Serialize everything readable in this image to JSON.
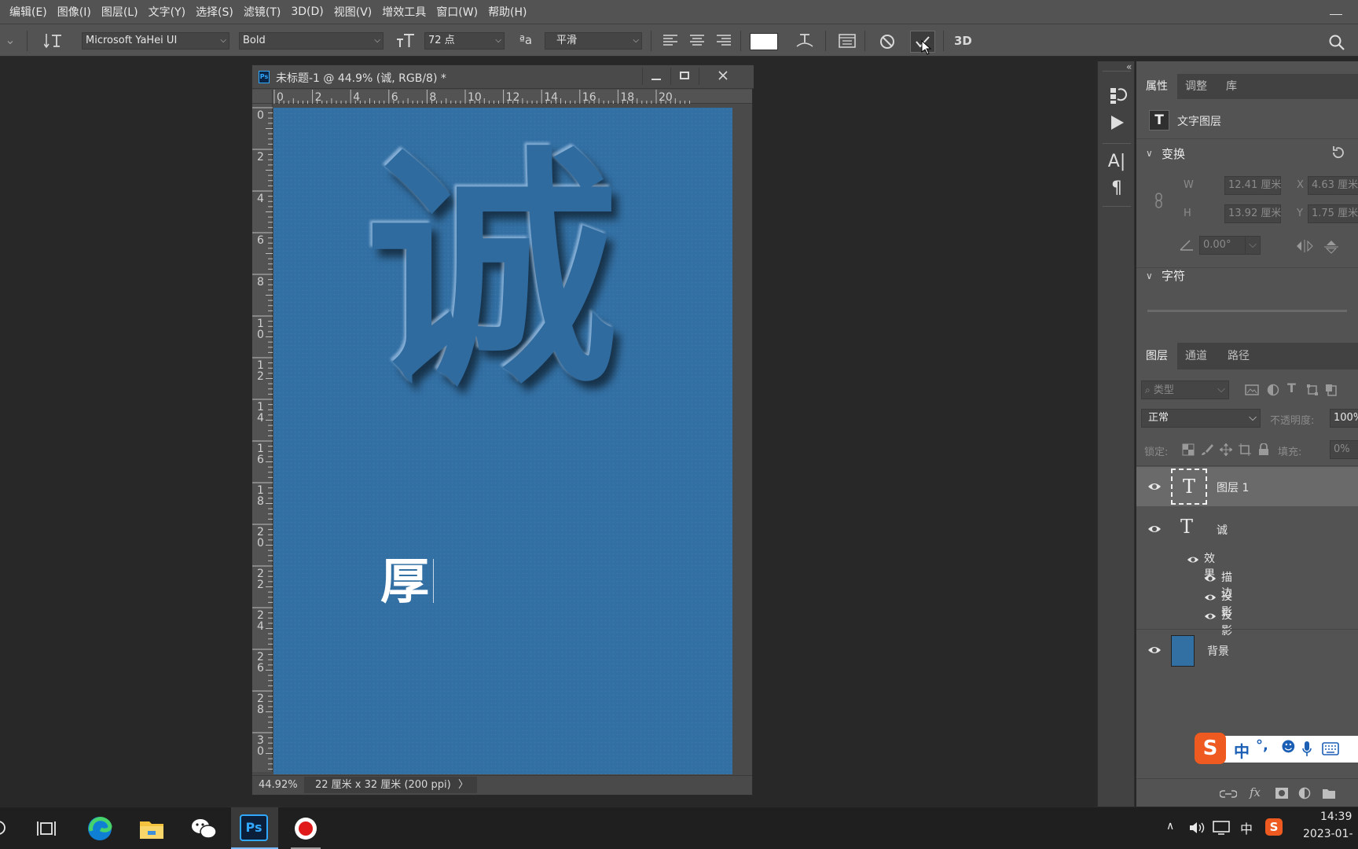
{
  "menubar": {
    "items": [
      "编辑(E)",
      "图像(I)",
      "图层(L)",
      "文字(Y)",
      "选择(S)",
      "滤镜(T)",
      "3D(D)",
      "视图(V)",
      "增效工具",
      "窗口(W)",
      "帮助(H)"
    ]
  },
  "options": {
    "font_family": "Microsoft YaHei UI",
    "font_style": "Bold",
    "font_size": "72 点",
    "antialias": "平滑",
    "three_d": "3D",
    "swatch_color": "#ffffff"
  },
  "document": {
    "title": "未标题-1 @ 44.9% (诚, RGB/8) *",
    "ps_badge": "Ps",
    "ruler_h": [
      "0",
      "2",
      "4",
      "6",
      "8",
      "10",
      "12",
      "14",
      "16",
      "18",
      "20"
    ],
    "ruler_v": [
      [
        "0"
      ],
      [
        "2"
      ],
      [
        "4"
      ],
      [
        "6"
      ],
      [
        "8"
      ],
      [
        "1",
        "0"
      ],
      [
        "1",
        "2"
      ],
      [
        "1",
        "4"
      ],
      [
        "1",
        "6"
      ],
      [
        "1",
        "8"
      ],
      [
        "2",
        "0"
      ],
      [
        "2",
        "2"
      ],
      [
        "2",
        "4"
      ],
      [
        "2",
        "6"
      ],
      [
        "2",
        "8"
      ],
      [
        "3",
        "0"
      ]
    ],
    "big_char": "诚",
    "small_char": "厚",
    "zoom": "44.92%",
    "dims": "22 厘米 x 32 厘米 (200 ppi)",
    "dims_arrow": "〉",
    "canvas_color": "#326fa3"
  },
  "properties": {
    "tabs": [
      "属性",
      "调整",
      "库"
    ],
    "layer_type": "文字图层",
    "transform_title": "变换",
    "w_label": "W",
    "w_value": "12.41 厘米",
    "h_label": "H",
    "h_value": "13.92 厘米",
    "x_label": "X",
    "x_value": "4.63 厘米",
    "y_label": "Y",
    "y_value": "1.75 厘米",
    "angle_value": "0.00°",
    "character_title": "字符"
  },
  "layers": {
    "tabs": [
      "图层",
      "通道",
      "路径"
    ],
    "filter_kind": "类型",
    "blend_mode": "正常",
    "opacity_label": "不透明度:",
    "opacity_value": "100%",
    "lock_label": "锁定:",
    "fill_label": "填充:",
    "fill_value": "0%",
    "items": [
      {
        "name": "图层 1"
      },
      {
        "name": "诚"
      },
      {
        "name": "背景"
      }
    ],
    "effects_label": "效果",
    "effects": [
      "描边",
      "投影",
      "投影"
    ],
    "footer_fx": "fx"
  },
  "ime": {
    "lang": "中",
    "punct": "°,"
  },
  "taskbar": {
    "ps_label": "Ps",
    "tray_lang": "中",
    "time": "14:39",
    "date": "2023-01-"
  }
}
